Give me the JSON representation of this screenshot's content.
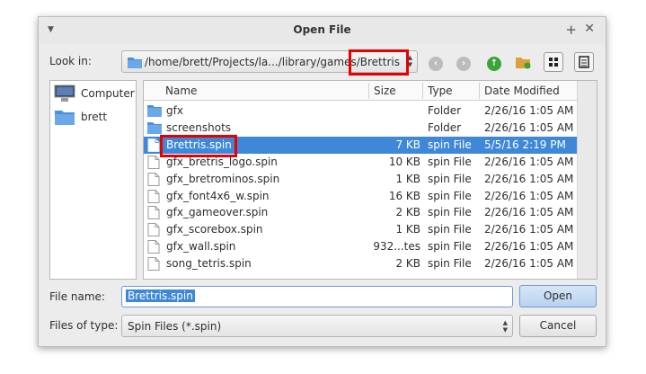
{
  "window": {
    "title": "Open File"
  },
  "toolbar": {
    "look_in_label": "Look in:",
    "path": "/home/brett/Projects/la.../library/games/Brettris"
  },
  "places": [
    {
      "label": "Computer",
      "icon": "computer-icon"
    },
    {
      "label": "brett",
      "icon": "folder-icon"
    }
  ],
  "columns": {
    "name": "Name",
    "size": "Size",
    "type": "Type",
    "date": "Date Modified"
  },
  "files": [
    {
      "name": "gfx",
      "size": "",
      "type": "Folder",
      "date": "2/26/16 1:05 AM",
      "kind": "folder"
    },
    {
      "name": "screenshots",
      "size": "",
      "type": "Folder",
      "date": "2/26/16 1:05 AM",
      "kind": "folder"
    },
    {
      "name": "Brettris.spin",
      "size": "7 KB",
      "type": "spin File",
      "date": "5/5/16 2:19 PM",
      "kind": "file",
      "selected": true
    },
    {
      "name": "gfx_bretris_logo.spin",
      "size": "10 KB",
      "type": "spin File",
      "date": "2/26/16 1:05 AM",
      "kind": "file"
    },
    {
      "name": "gfx_bretrominos.spin",
      "size": "1 KB",
      "type": "spin File",
      "date": "2/26/16 1:05 AM",
      "kind": "file"
    },
    {
      "name": "gfx_font4x6_w.spin",
      "size": "16 KB",
      "type": "spin File",
      "date": "2/26/16 1:05 AM",
      "kind": "file"
    },
    {
      "name": "gfx_gameover.spin",
      "size": "2 KB",
      "type": "spin File",
      "date": "2/26/16 1:05 AM",
      "kind": "file"
    },
    {
      "name": "gfx_scorebox.spin",
      "size": "1 KB",
      "type": "spin File",
      "date": "2/26/16 1:05 AM",
      "kind": "file"
    },
    {
      "name": "gfx_wall.spin",
      "size": "932...tes",
      "type": "spin File",
      "date": "2/26/16 1:05 AM",
      "kind": "file"
    },
    {
      "name": "song_tetris.spin",
      "size": "2 KB",
      "type": "spin File",
      "date": "2/26/16 1:05 AM",
      "kind": "file"
    }
  ],
  "filename": {
    "label": "File name:",
    "value": "Brettris.spin"
  },
  "filetype": {
    "label": "Files of type:",
    "value": "Spin Files (*.spin)"
  },
  "buttons": {
    "open": "Open",
    "cancel": "Cancel"
  },
  "colors": {
    "accent": "#3f88d8",
    "highlight": "#e60000"
  }
}
